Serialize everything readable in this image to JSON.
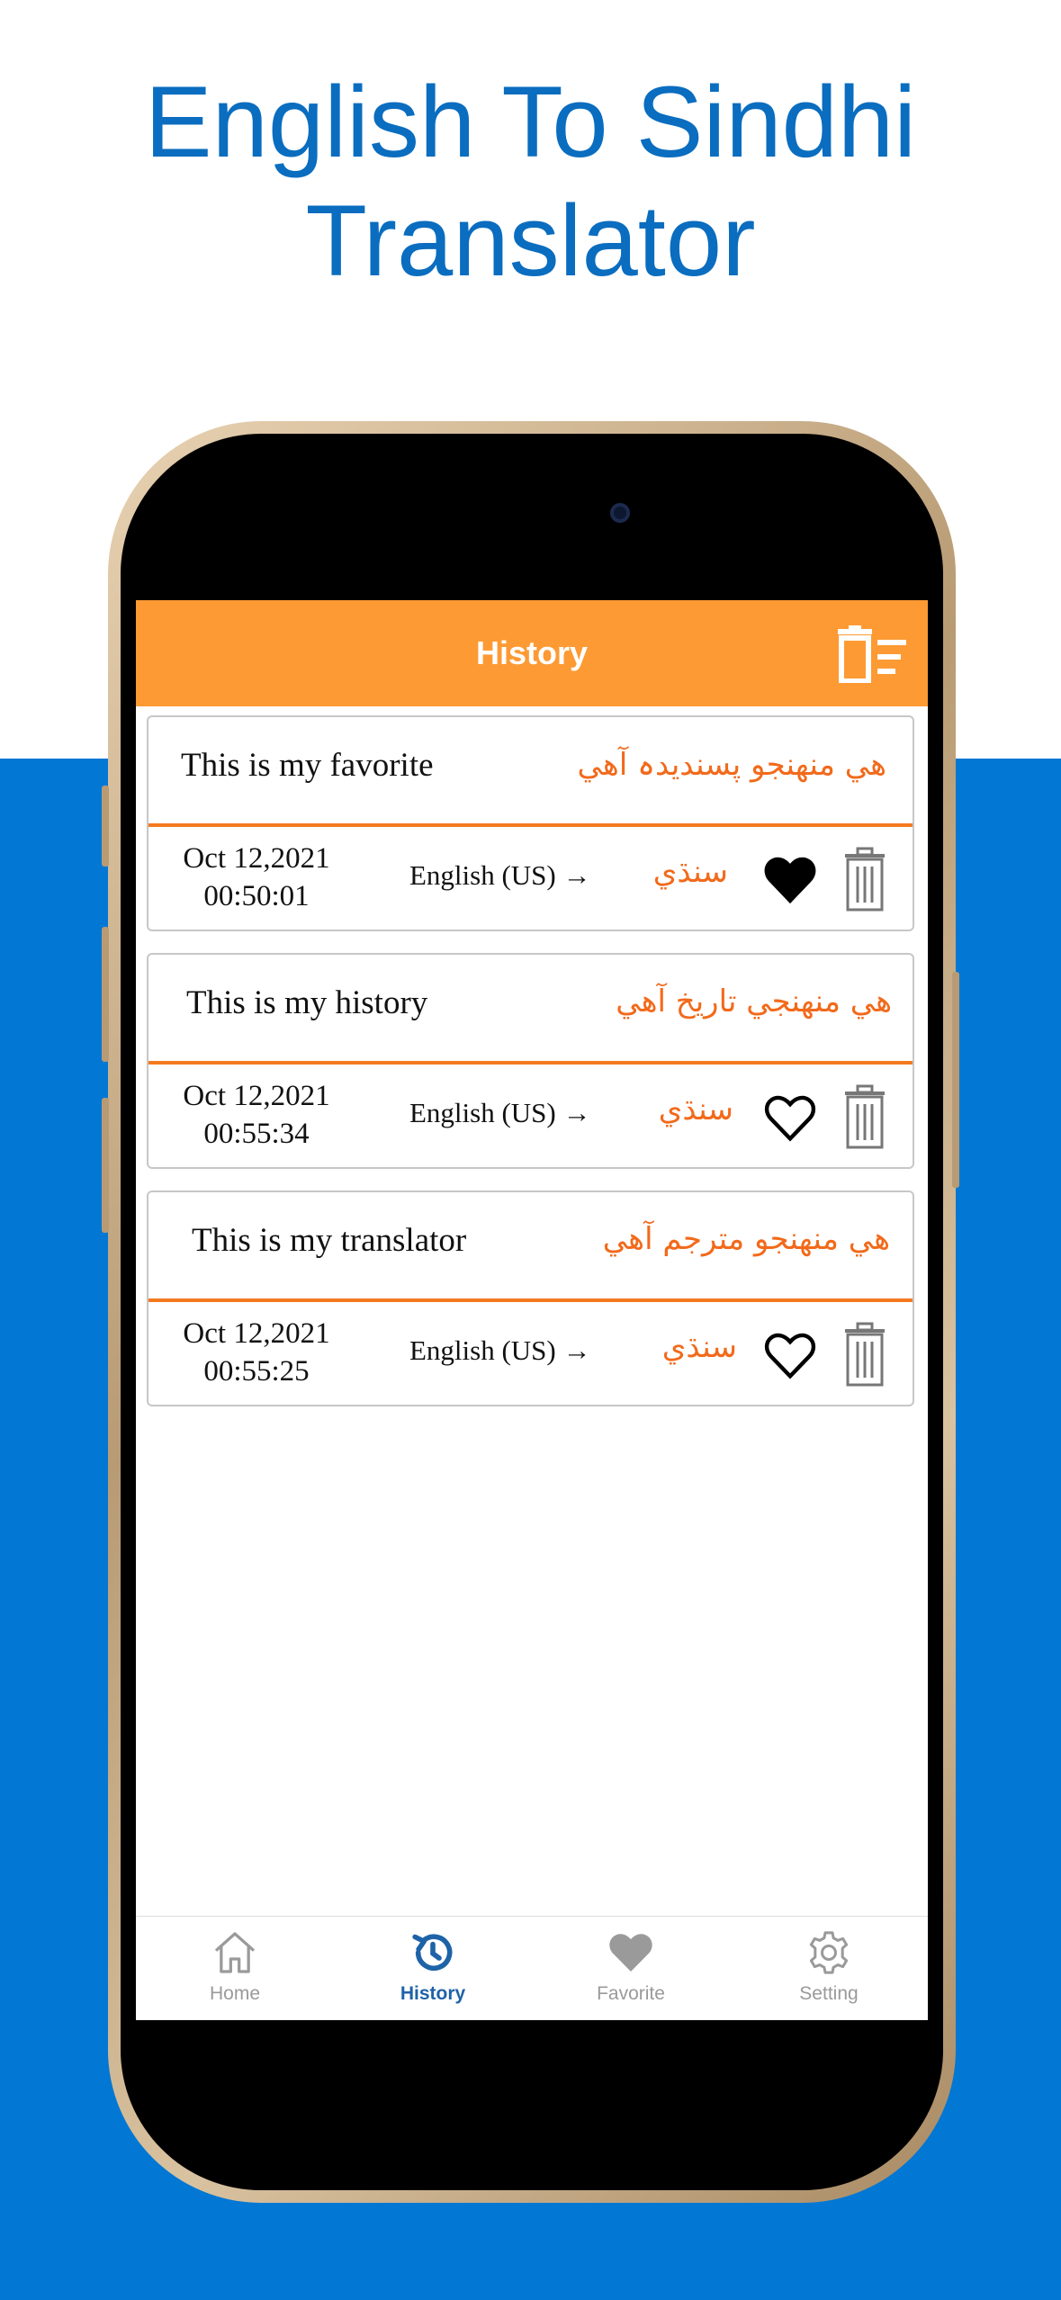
{
  "headline": {
    "line1": "English To Sindhi",
    "line2": "Translator"
  },
  "header": {
    "title": "History",
    "clear_icon": "delete-all-icon"
  },
  "history": [
    {
      "source": "This is my favorite",
      "target": "ھي منھنجو پسنديدہ آھي",
      "date": "Oct 12,2021",
      "time": "00:50:01",
      "from_lang": "English (US) →",
      "to_lang": "سنڌي",
      "favorite": true
    },
    {
      "source": "This is my history",
      "target": "ھي منھنجي تاريخ آھي",
      "date": "Oct 12,2021",
      "time": "00:55:34",
      "from_lang": "English (US) →",
      "to_lang": "سنڌي",
      "favorite": false
    },
    {
      "source": "This is my translator",
      "target": "ھي منھنجو مترجم آھي",
      "date": "Oct 12,2021",
      "time": "00:55:25",
      "from_lang": "English (US) →",
      "to_lang": "سنڌي",
      "favorite": false
    }
  ],
  "nav": {
    "items": [
      {
        "label": "Home",
        "icon": "home-icon",
        "active": false
      },
      {
        "label": "History",
        "icon": "history-icon",
        "active": true
      },
      {
        "label": "Favorite",
        "icon": "heart-icon",
        "active": false
      },
      {
        "label": "Setting",
        "icon": "gear-icon",
        "active": false
      }
    ]
  },
  "colors": {
    "accent_orange": "#fd9a33",
    "text_orange": "#f26a1b",
    "brand_blue": "#0277d4",
    "active_nav": "#1e63a8"
  }
}
